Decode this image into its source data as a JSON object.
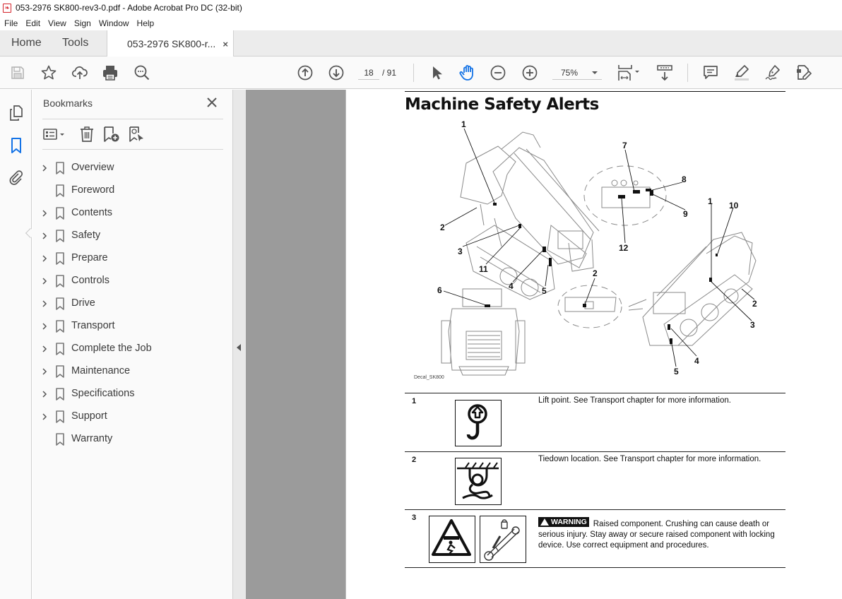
{
  "window": {
    "title": "053-2976 SK800-rev3-0.pdf - Adobe Acrobat Pro DC (32-bit)"
  },
  "menu": [
    "File",
    "Edit",
    "View",
    "Sign",
    "Window",
    "Help"
  ],
  "tabs": {
    "home": "Home",
    "tools": "Tools",
    "document": "053-2976 SK800-r...",
    "close_symbol": "×"
  },
  "toolbar": {
    "left_icons": [
      "save-icon",
      "star-icon",
      "upload-cloud-icon",
      "print-icon",
      "find-text-icon"
    ],
    "page_current": "18",
    "page_total": "/ 91",
    "zoom_value": "75%",
    "nav_icons": [
      "previous-page-icon",
      "next-page-icon"
    ],
    "tool_icons": [
      "select-pointer-icon",
      "hand-tool-icon",
      "zoom-out-icon",
      "zoom-in-icon"
    ],
    "right_icons": [
      "fit-page-icon",
      "scrolling-mode-icon",
      "comment-icon",
      "highlight-icon",
      "sign-icon",
      "edit-pdf-icon"
    ],
    "active_color": "#1473e6"
  },
  "rail": {
    "icons": [
      "page-thumbnails-icon",
      "bookmarks-icon",
      "attachments-icon"
    ],
    "active": "bookmarks-icon"
  },
  "bookmarks_panel": {
    "title": "Bookmarks",
    "tools": [
      "options-menu-icon",
      "delete-bookmark-icon",
      "new-bookmark-icon",
      "bookmark-from-selection-icon"
    ],
    "items": [
      {
        "label": "Overview",
        "expandable": true
      },
      {
        "label": "Foreword",
        "expandable": false
      },
      {
        "label": "Contents",
        "expandable": true
      },
      {
        "label": "Safety",
        "expandable": true
      },
      {
        "label": "Prepare",
        "expandable": true
      },
      {
        "label": "Controls",
        "expandable": true
      },
      {
        "label": "Drive",
        "expandable": true
      },
      {
        "label": "Transport",
        "expandable": true
      },
      {
        "label": "Complete the Job",
        "expandable": true
      },
      {
        "label": "Maintenance",
        "expandable": true
      },
      {
        "label": "Specifications",
        "expandable": true
      },
      {
        "label": "Support",
        "expandable": true
      },
      {
        "label": "Warranty",
        "expandable": false
      }
    ]
  },
  "document": {
    "heading": "Machine Safety Alerts",
    "figure_caption": "Decal_SK800",
    "callouts": [
      "1",
      "2",
      "3",
      "11",
      "4",
      "5",
      "6",
      "7",
      "8",
      "9",
      "12",
      "1",
      "10",
      "2",
      "2",
      "3",
      "4",
      "5"
    ],
    "rows": [
      {
        "num": "1",
        "symbol": "lift-point-icon",
        "text": "Lift point. See Transport chapter for more information."
      },
      {
        "num": "2",
        "symbol": "tiedown-icon",
        "text": "Tiedown location. See Transport chapter for more information."
      },
      {
        "num": "3",
        "symbols": [
          "crush-hazard-icon",
          "cylinder-lock-icon"
        ],
        "badge": "WARNING",
        "text": "Raised component. Crushing can cause death or serious injury. Stay away or secure raised component with locking device. Use correct equipment and procedures."
      }
    ]
  }
}
